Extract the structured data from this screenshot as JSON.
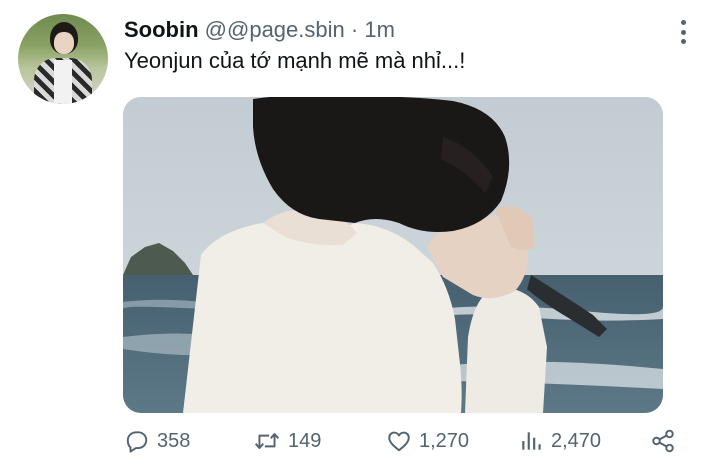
{
  "tweet": {
    "author_name": "Soobin",
    "author_handle": "@@page.sbin",
    "separator": "·",
    "time": "1m",
    "text": "Yeonjun của tớ mạnh mẽ mà nhỉ...!"
  },
  "actions": {
    "replies": "358",
    "retweets": "149",
    "likes": "1,270",
    "views": "2,470"
  },
  "icons": {
    "reply": "reply-icon",
    "retweet": "retweet-icon",
    "like": "heart-icon",
    "views": "views-icon",
    "share": "share-icon",
    "more": "more-options-icon"
  },
  "colors": {
    "text_primary": "#0f1419",
    "text_secondary": "#536471",
    "background": "#ffffff"
  }
}
